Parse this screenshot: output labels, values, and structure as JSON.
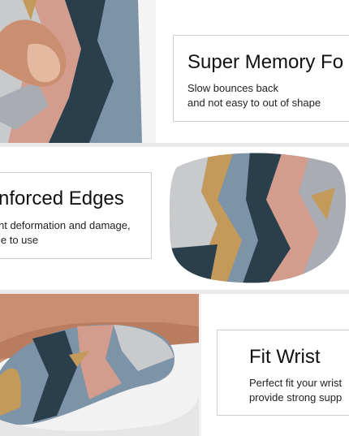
{
  "features": [
    {
      "title": "Super Memory Fo",
      "body": [
        "Slow bounces back",
        "and not easy to out of shape"
      ]
    },
    {
      "title": "nforced Edges",
      "body": [
        "nt deformation and damage,",
        "le to use"
      ]
    },
    {
      "title": "Fit Wrist",
      "body": [
        "Perfect fit your wrist",
        "provide strong supp"
      ]
    }
  ],
  "colors": {
    "navy": "#2b3e4c",
    "slate": "#7d93a8",
    "gold": "#c39a5a",
    "rose": "#d39c8d",
    "grey": "#c9cacc",
    "skin": "#c98f70"
  }
}
